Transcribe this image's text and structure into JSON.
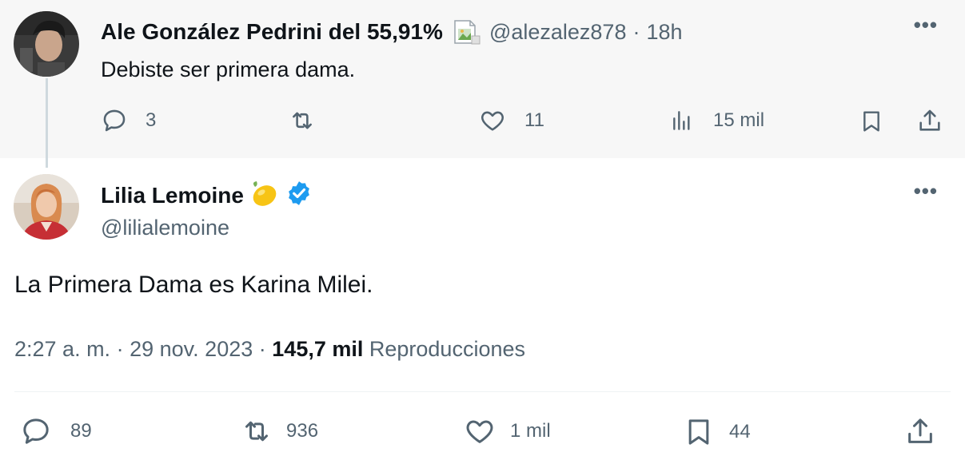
{
  "reply": {
    "author_name": "Ale González Pedrini del 55,91%",
    "handle": "@alezalez878",
    "separator": "·",
    "time": "18h",
    "more_icon": "•••",
    "text": "Debiste ser primera dama.",
    "actions": {
      "replies": "3",
      "reposts": "",
      "likes": "11",
      "views": "15 mil"
    }
  },
  "tweet": {
    "author_name": "Lilia Lemoine",
    "emoji": "lemon",
    "verified_color": "#1d9bf0",
    "handle": "@lilialemoine",
    "more_icon": "•••",
    "text": "La Primera Dama es Karina Milei.",
    "time": "2:27 a. m.",
    "date": "29 nov. 2023",
    "separator": "·",
    "views_count": "145,7 mil",
    "views_label": "Reproducciones",
    "actions": {
      "replies": "89",
      "reposts": "936",
      "likes": "1 mil",
      "bookmarks": "44"
    }
  },
  "colors": {
    "text_primary": "#0f1419",
    "text_secondary": "#536471",
    "reply_background": "#f7f7f7"
  }
}
